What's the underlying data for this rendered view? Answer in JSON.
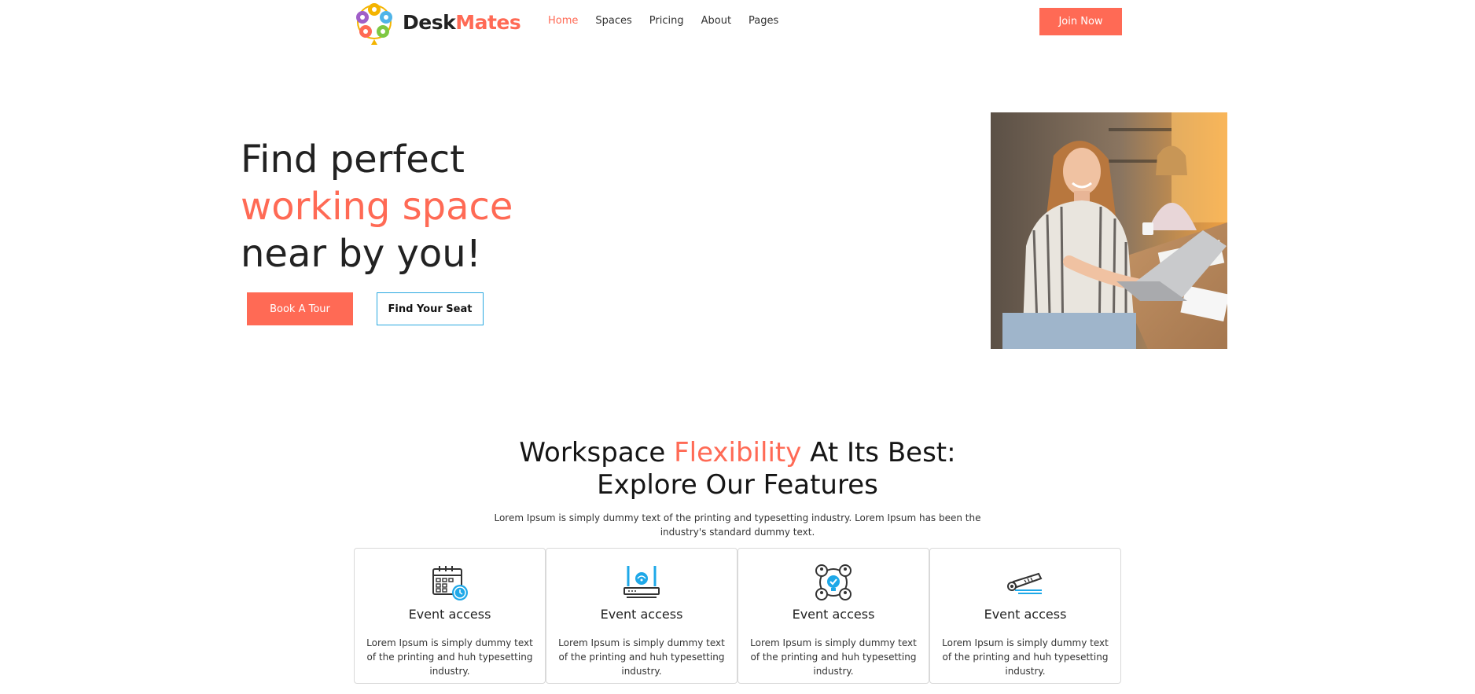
{
  "brand": {
    "name_part1": "Desk",
    "name_part2": "Mates",
    "accent": "#ff6a55",
    "icon": "logo-mark-icon"
  },
  "nav": {
    "items": [
      {
        "label": "Home",
        "active": true
      },
      {
        "label": "Spaces",
        "active": false
      },
      {
        "label": "Pricing",
        "active": false
      },
      {
        "label": "About",
        "active": false
      },
      {
        "label": "Pages",
        "active": false
      }
    ],
    "cta_label": "Join Now"
  },
  "hero": {
    "line1": "Find perfect",
    "line2": "working space",
    "line3": "near by you!",
    "primary_button": "Book A Tour",
    "secondary_button": "Find Your Seat",
    "image": "woman-working-on-laptop-photo"
  },
  "features": {
    "heading_part1": "Workspace ",
    "heading_accent": "Flexibility",
    "heading_part2": " At Its Best:",
    "heading_line2": "Explore Our Features",
    "description": "Lorem Ipsum is simply dummy text of the printing and typesetting industry. Lorem Ipsum has been the industry's standard dummy text.",
    "cards": [
      {
        "icon": "calendar-clock-icon",
        "title": "Event access",
        "text": "Lorem Ipsum is simply dummy text of the printing and huh typesetting industry."
      },
      {
        "icon": "wifi-router-icon",
        "title": "Event access",
        "text": "Lorem Ipsum is simply dummy text of the printing and huh typesetting industry."
      },
      {
        "icon": "network-people-icon",
        "title": "Event access",
        "text": "Lorem Ipsum is simply dummy text of the printing and huh typesetting industry."
      },
      {
        "icon": "projector-icon",
        "title": "Event access",
        "text": "Lorem Ipsum is simply dummy text of the printing and huh typesetting industry."
      }
    ]
  },
  "colors": {
    "accent": "#ff6a55",
    "icon_blue": "#1ea8e8",
    "text_dark": "#222222",
    "outline_button": "#2aa9e0"
  }
}
